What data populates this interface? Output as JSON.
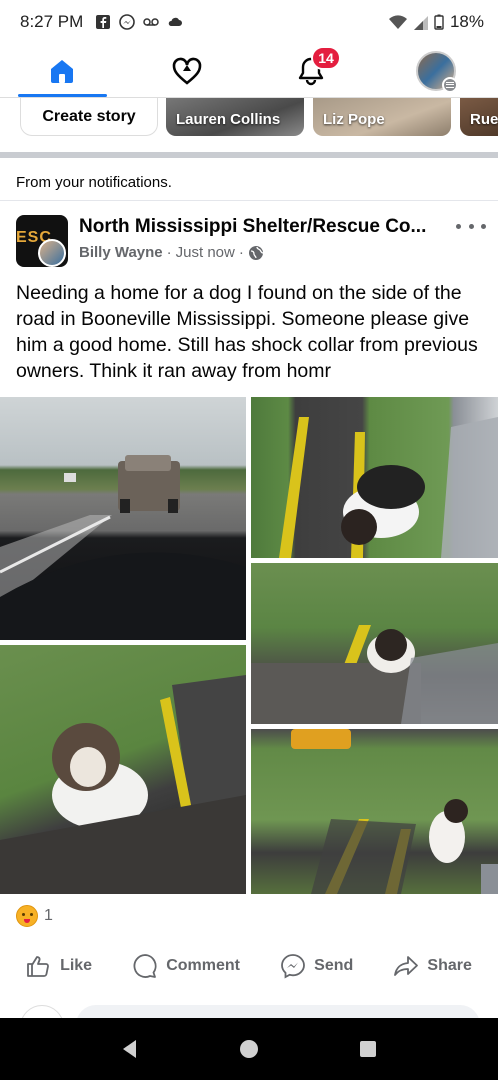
{
  "status_bar": {
    "time": "8:27 PM",
    "battery": "18%"
  },
  "nav": {
    "notification_count": "14"
  },
  "stories": {
    "create_label": "Create story",
    "items": [
      {
        "name": "Lauren Collins"
      },
      {
        "name": "Liz Pope"
      },
      {
        "name": "Rue"
      }
    ]
  },
  "post": {
    "context": "From your notifications.",
    "page_name": "North Mississippi Shelter/Rescue Co...",
    "page_logo_text": "ESC",
    "author": "Billy Wayne",
    "time": "Just now",
    "separator": "·",
    "text": "Needing a home for a dog I found on the side of the road in Booneville Mississippi. Someone please give him a good home. Still has shock collar from previous owners. Think it ran away from homr",
    "reaction_count": "1",
    "actions": {
      "like": "Like",
      "comment": "Comment",
      "send": "Send",
      "share": "Share"
    }
  },
  "colors": {
    "accent": "#1877f2",
    "badge": "#e41e3f",
    "muted": "#65676b"
  }
}
